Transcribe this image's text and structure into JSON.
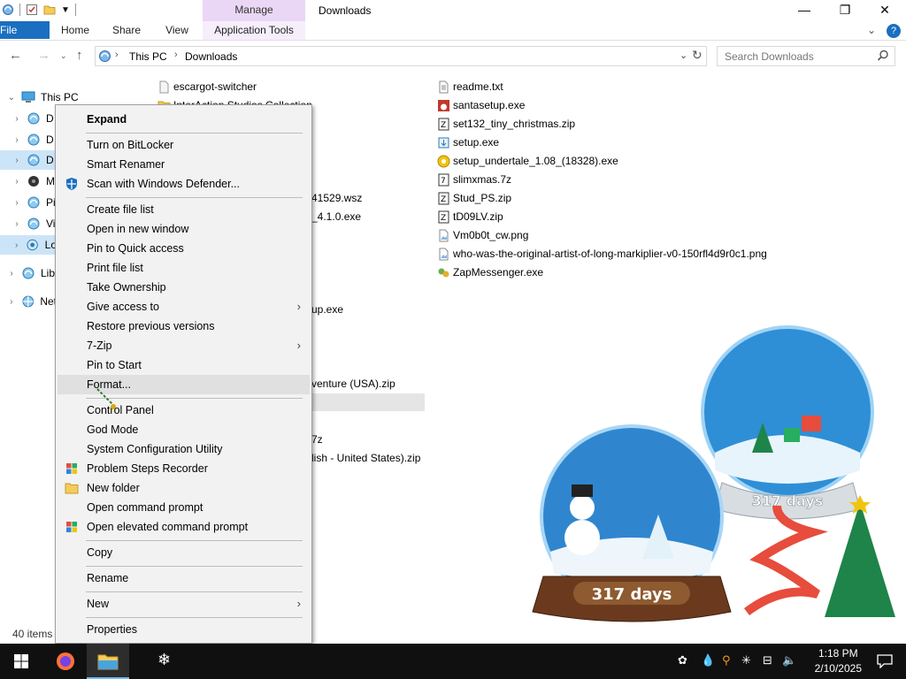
{
  "window": {
    "title": "Downloads",
    "manage_tab": "Manage",
    "minimize": "—",
    "maximize": "❐",
    "close": "✕"
  },
  "ribbon": {
    "tabs": [
      "File",
      "Home",
      "Share",
      "View",
      "Application Tools"
    ],
    "expand_chevron": "⌄",
    "help": "?"
  },
  "address": {
    "crumbs": [
      "This PC",
      "Downloads"
    ],
    "search_placeholder": "Search Downloads"
  },
  "nav": {
    "items": [
      {
        "label": "This PC",
        "icon": "this-pc-icon"
      },
      {
        "label": "D",
        "icon": "drive-icon"
      },
      {
        "label": "D",
        "icon": "drive-icon"
      },
      {
        "label": "D",
        "icon": "drive-icon"
      },
      {
        "label": "M",
        "icon": "music-icon"
      },
      {
        "label": "Pi",
        "icon": "pictures-icon"
      },
      {
        "label": "Vi",
        "icon": "videos-icon"
      },
      {
        "label": "Lo",
        "icon": "local-disk-icon"
      },
      {
        "label": "Lib",
        "icon": "libraries-icon"
      },
      {
        "label": "Net",
        "icon": "network-icon"
      }
    ]
  },
  "files": {
    "left_column": [
      {
        "name": "escargot-switcher"
      },
      {
        "name": "InterAction Studios Collection"
      },
      {
        "name": "41529.wsz"
      },
      {
        "name": "_4.1.0.exe"
      },
      {
        "name": "up.exe"
      },
      {
        "name": "venture (USA).zip"
      },
      {
        "name": "7z"
      },
      {
        "name": "lish - United States).zip"
      }
    ],
    "right_column": [
      {
        "name": "readme.txt"
      },
      {
        "name": "santasetup.exe"
      },
      {
        "name": "set132_tiny_christmas.zip"
      },
      {
        "name": "setup.exe"
      },
      {
        "name": "setup_undertale_1.08_(18328).exe"
      },
      {
        "name": "slimxmas.7z"
      },
      {
        "name": "Stud_PS.zip"
      },
      {
        "name": "tD09LV.zip"
      },
      {
        "name": "Vm0b0t_cw.png"
      },
      {
        "name": "who-was-the-original-artist-of-long-markiplier-v0-150rfl4d9r0c1.png"
      },
      {
        "name": "ZapMessenger.exe"
      }
    ]
  },
  "status": {
    "items_count": "40 items"
  },
  "context_menu": {
    "items": [
      {
        "label": "Expand"
      },
      {
        "label": "Turn on BitLocker"
      },
      {
        "label": "Smart Renamer"
      },
      {
        "label": "Scan with Windows Defender..."
      },
      {
        "label": "Create file list"
      },
      {
        "label": "Open in new window"
      },
      {
        "label": "Pin to Quick access"
      },
      {
        "label": "Print file list"
      },
      {
        "label": "Take Ownership"
      },
      {
        "label": "Give access to"
      },
      {
        "label": "Restore previous versions"
      },
      {
        "label": "7-Zip"
      },
      {
        "label": "Pin to Start"
      },
      {
        "label": "Format..."
      },
      {
        "label": "Control Panel"
      },
      {
        "label": "God Mode"
      },
      {
        "label": "System Configuration Utility"
      },
      {
        "label": "Problem Steps Recorder"
      },
      {
        "label": "New folder"
      },
      {
        "label": "Open command prompt"
      },
      {
        "label": "Open elevated command prompt"
      },
      {
        "label": "Copy"
      },
      {
        "label": "Rename"
      },
      {
        "label": "New"
      },
      {
        "label": "Properties"
      }
    ],
    "submenu_arrow": "›"
  },
  "desktop": {
    "globe_left_days": "317 days",
    "globe_right_days": "317 days"
  },
  "taskbar": {
    "time": "1:18 PM",
    "date": "2/10/2025"
  },
  "colors": {
    "accent": "#1a6fc0",
    "manage": "#e9d7f5",
    "taskbar": "#101010",
    "selection": "#cce4f7"
  }
}
